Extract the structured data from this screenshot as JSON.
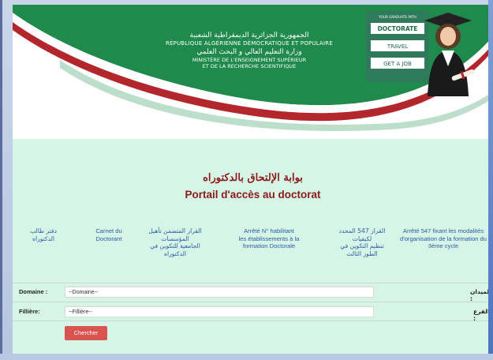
{
  "banner": {
    "ar_republic": "الجمهورية الجزائرية الديمقراطية الشعبية",
    "fr_republic": "RÉPUBLIQUE ALGÉRIENNE DÉMOCRATIQUE ET POPULAIRE",
    "ar_ministry": "وزارة التعليم العالي و البحث العلمي",
    "fr_ministry_1": "MINISTÈRE DE L'ENSEIGNEMENT SUPÉRIEUR",
    "fr_ministry_2": "ET DE LA RECHERCHE SCIENTIFIQUE",
    "sign_top": "YOUR GRADUATE PATH",
    "sign_1": "DOCTORATE",
    "sign_2": "TRAVEL",
    "sign_3": "GET A JOB"
  },
  "portal": {
    "title_ar": "بوابة الإلتحاق بالدكتوراه",
    "title_fr": "Portail d'accès au doctorat"
  },
  "links": [
    {
      "l1": "دفتر طالب",
      "l2": "الدكتوراه",
      "l3": "",
      "l4": ""
    },
    {
      "l1": "Carnet du",
      "l2": "Doctorant",
      "l3": "",
      "l4": ""
    },
    {
      "l1": "القرار      المتضمن تأهيل",
      "l2": "المؤسسات",
      "l3": "الجامعية للتكوين في",
      "l4": "الدكتوراه"
    },
    {
      "l1": "Arrêté N°        habilitant",
      "l2": "les établissements à la",
      "l3": "formation Doctorale",
      "l4": ""
    },
    {
      "l1": "القرار 547 المحدد",
      "l2": "لكيفيات",
      "l3": "تنظيم التكوين في",
      "l4": "الطور الثالث"
    },
    {
      "l1": "Arrêté 547 fixant les modalités",
      "l2": "d'organisation de la formation du",
      "l3": "3ème cycle",
      "l4": ""
    }
  ],
  "form": {
    "domaine_label": "Domaine :",
    "domaine_label_ar": "الميدان :",
    "domaine_value": "--Domaine--",
    "filiere_label": "Fillière:",
    "filiere_label_ar": "الفرع :",
    "filiere_value": "--Fillière--",
    "search_button": "Chercher"
  },
  "colors": {
    "green": "#1f8a4c",
    "red": "#b3262b",
    "page_bg": "#d6f5e6",
    "title": "#8b1a1a",
    "link": "#2a5aa8",
    "button": "#d9534f"
  }
}
